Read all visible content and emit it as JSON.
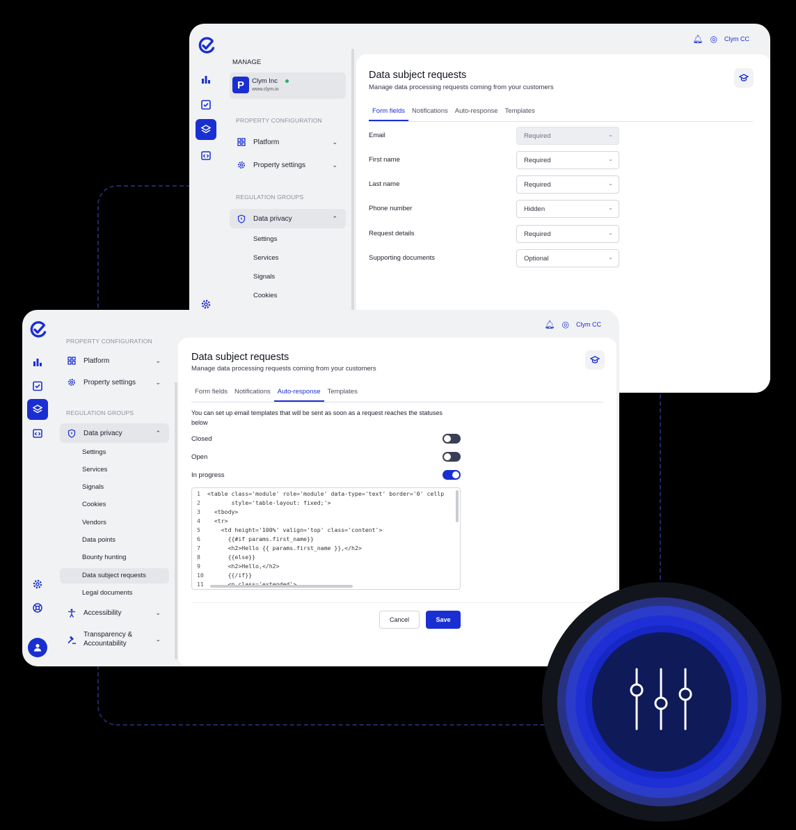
{
  "back": {
    "header": {
      "account": "Clym CC"
    },
    "sidebar": {
      "manage_label": "MANAGE",
      "org": {
        "initial": "P",
        "name": "Clym Inc",
        "url": "www.clym.io"
      },
      "property_config_label": "PROPERTY CONFIGURATION",
      "platform": "Platform",
      "property_settings": "Property settings",
      "regulation_groups_label": "REGULATION GROUPS",
      "data_privacy": "Data privacy",
      "sub_items": [
        "Settings",
        "Services",
        "Signals",
        "Cookies"
      ]
    },
    "main": {
      "title": "Data subject requests",
      "subtitle": "Manage data processing requests coming from your customers",
      "tabs": [
        "Form fields",
        "Notifications",
        "Auto-response",
        "Templates"
      ],
      "active_tab": "Form fields",
      "fields": [
        {
          "label": "Email",
          "value": "Required",
          "disabled": true
        },
        {
          "label": "First name",
          "value": "Required"
        },
        {
          "label": "Last name",
          "value": "Required"
        },
        {
          "label": "Phone number",
          "value": "Hidden"
        },
        {
          "label": "Request details",
          "value": "Required"
        },
        {
          "label": "Supporting documents",
          "value": "Optional"
        }
      ]
    }
  },
  "front": {
    "header": {
      "account": "Clym CC"
    },
    "sidebar": {
      "property_config_label": "PROPERTY CONFIGURATION",
      "platform": "Platform",
      "property_settings": "Property settings",
      "regulation_groups_label": "REGULATION GROUPS",
      "data_privacy": "Data privacy",
      "sub_items": [
        "Settings",
        "Services",
        "Signals",
        "Cookies",
        "Vendors",
        "Data points",
        "Bounty hunting",
        "Data subject requests",
        "Legal documents"
      ],
      "selected_sub": "Data subject requests",
      "accessibility": "Accessibility",
      "transparency_line1": "Transparency &",
      "transparency_line2": "Accountability"
    },
    "main": {
      "title": "Data subject requests",
      "subtitle": "Manage data processing requests coming from your customers",
      "tabs": [
        "Form fields",
        "Notifications",
        "Auto-response",
        "Templates"
      ],
      "active_tab": "Auto-response",
      "description_line1": "You can set up email templates that will be sent as soon as a request reaches the statuses",
      "description_line2": "below",
      "toggles": [
        {
          "label": "Closed",
          "on": false
        },
        {
          "label": "Open",
          "on": false
        },
        {
          "label": "In progress",
          "on": true
        }
      ],
      "code_lines": [
        {
          "n": "1",
          "text": "<table class='module' role='module' data-type='text' border='0' cellp"
        },
        {
          "n": "2",
          "text": "       style='table-layout: fixed;'>"
        },
        {
          "n": "3",
          "text": "  <tbody>"
        },
        {
          "n": "4",
          "text": "  <tr>"
        },
        {
          "n": "5",
          "text": "    <td height='100%' valign='top' class='content'>"
        },
        {
          "n": "6",
          "text": "      {{#if params.first_name}}"
        },
        {
          "n": "7",
          "text": "      <h2>Hello {{ params.first_name }},</h2>"
        },
        {
          "n": "8",
          "text": "      {{else}}"
        },
        {
          "n": "9",
          "text": "      <h2>Hello,</h2>"
        },
        {
          "n": "10",
          "text": "      {{/if}}"
        },
        {
          "n": "11",
          "text": "      <p class='extended'>"
        }
      ],
      "cancel_label": "Cancel",
      "save_label": "Save"
    }
  }
}
